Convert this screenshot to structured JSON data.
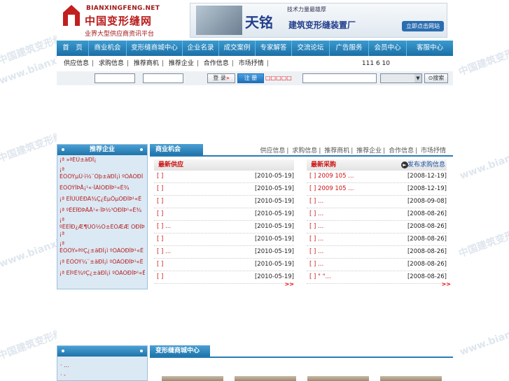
{
  "watermark": {
    "text_cn": "中国建筑变形缝网",
    "text_en": "www.bianxingfeng.net"
  },
  "header": {
    "logo_domain": "BIANXINGFENG.NET",
    "logo_cn": "中国变形缝网",
    "logo_slogan": "业界大型供应商资讯平台",
    "banner_tag": "技术力量最雄厚",
    "banner_brand": "天铭",
    "banner_title": "建筑变形缝装置厂",
    "banner_button": "立即点击网站"
  },
  "nav": [
    {
      "label": "首　页"
    },
    {
      "label": "商业机会"
    },
    {
      "label": "变形缝商城中心"
    },
    {
      "label": "企业名录"
    },
    {
      "label": "成交案例"
    },
    {
      "label": "专家解答"
    },
    {
      "label": "交流论坛"
    },
    {
      "label": "广告服务"
    },
    {
      "label": "会员中心"
    },
    {
      "label": "客服中心"
    }
  ],
  "subnav": {
    "items": [
      "供应信息",
      "求购信息",
      "推荐商机",
      "推荐企业",
      "合作信息",
      "市场抒情"
    ],
    "count_text": "111 6 10"
  },
  "login": {
    "login_button": "登 录",
    "register_button": "注 册",
    "register_link": "□□□□□",
    "search_button": "搜索"
  },
  "sidebar": {
    "title": "推荐企业",
    "items": [
      "¡ª »ªÉÙ±äÐÎ¡",
      "¡ª",
      "ÉÖÖÝµÛ·ì½¨Öþ±äÐÎ¡ì ºÓÀÓÐÎ",
      "ÉÖÖÝÎÞÅ¡¹«·ÏÀÌÓÐÏÞ¹«Ë¾",
      "¡ª ÉÏÙÚÈÐÂ¾Ç¿ÉµÕµÓÐÎÞ¹«Ë",
      "¡ª ºÊÉÏÐÞÃÅ¹«·ÏÞ½³ÓÐÎÞ¹«Ë¾",
      "¡ª",
      "ºÊÉÏÐ¿Æ¶ÙÓ½Ò±ÊÓÆÆ ÓÐÎÞ",
      "¡ª",
      "¡ª",
      "ÉÖÖÝ»ªºÇ¿±äÐÎ¡ì ºÓÀÓÐÎÞ¹«Ë",
      "¡ª ÉÖÖÝ¼¨±äÐÎ¡ì ºÓÀÓÐÎÞ¹«Ë",
      "¡ª ÉÏºË¾ºÇ¿±äÐÎ¡ì ºÓÀÓÐÎÞ¹«Ë"
    ]
  },
  "business": {
    "tab_title": "商业机会",
    "tab_links": [
      "供应信息",
      "求购信息",
      "推荐商机",
      "推荐企业",
      "合作信息",
      "市场抒情"
    ],
    "supply": {
      "title": "最新供应",
      "rows": [
        {
          "title": "[ ]",
          "date": "[2010-05-19]"
        },
        {
          "title": "[ ]",
          "date": "[2010-05-19]"
        },
        {
          "title": "[ ]",
          "date": "[2010-05-19]"
        },
        {
          "title": "[ ]",
          "date": "[2010-05-19]"
        },
        {
          "title": "[ ]          ...",
          "date": "[2010-05-19]"
        },
        {
          "title": "[ ]",
          "date": "[2010-05-19]"
        },
        {
          "title": "[ ]          ...",
          "date": "[2010-05-19]"
        },
        {
          "title": "[ ]",
          "date": "[2010-05-19]"
        },
        {
          "title": "[ ]",
          "date": "[2010-05-19]"
        }
      ],
      "more": ">>"
    },
    "purchase": {
      "title": "最新采购",
      "more_link": "发布求购信息",
      "rows": [
        {
          "title": "[ ] 2009  105      ...",
          "date": "[2008-12-19]"
        },
        {
          "title": "[ ] 2009  105      ...",
          "date": "[2008-12-19]"
        },
        {
          "title": "[ ]              ...",
          "date": "[2008-09-08]"
        },
        {
          "title": "[ ]              ...",
          "date": "[2008-08-26]"
        },
        {
          "title": "[ ]              ...",
          "date": "[2008-08-26]"
        },
        {
          "title": "[ ]              ...",
          "date": "[2008-08-26]"
        },
        {
          "title": "[ ]              ...",
          "date": "[2008-08-26]"
        },
        {
          "title": "[ ]              ...",
          "date": "[2008-08-26]"
        },
        {
          "title": "[ ] \"     \"...",
          "date": "[2008-08-26]"
        }
      ],
      "more": ">>"
    }
  },
  "bottom": {
    "tab_title": "变形缝商城中心",
    "side_items": [
      "·        ...",
      "·  -"
    ]
  },
  "colors": {
    "nav_blue": "#1b6fa6",
    "accent_red": "#c11111"
  }
}
